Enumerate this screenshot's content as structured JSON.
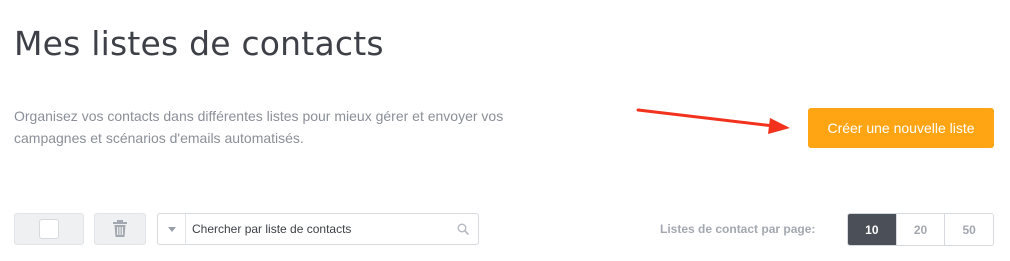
{
  "header": {
    "title": "Mes listes de contacts",
    "description": "Organisez vos contacts dans différentes listes pour mieux gérer et envoyer vos campagnes et scénarios d'emails automatisés."
  },
  "actions": {
    "create_label": "Créer une nouvelle liste",
    "accent_color": "#ffa412",
    "arrow_color": "#f2321c"
  },
  "toolbar": {
    "search_placeholder": "Chercher par liste de contacts",
    "delete_icon": "trash-icon",
    "search_icon": "search-icon",
    "filter_icon": "caret-down-icon"
  },
  "pagination": {
    "label": "Listes de contact par page:",
    "options": [
      "10",
      "20",
      "50"
    ],
    "selected": "10"
  }
}
